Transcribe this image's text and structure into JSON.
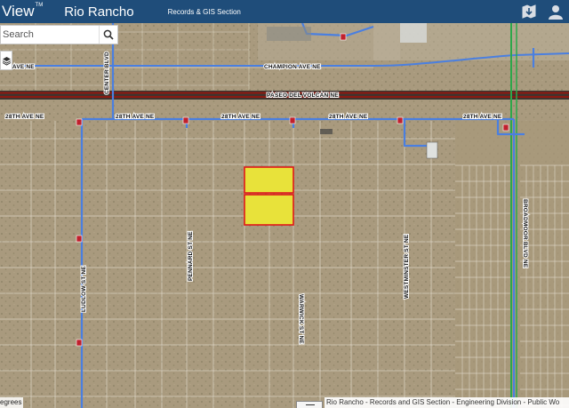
{
  "header": {
    "brand": "View",
    "brand_sup": "TM",
    "title": "Rio Rancho",
    "subtitle": "Records & GIS Section",
    "icons": [
      "map-export-icon",
      "user-icon"
    ]
  },
  "search": {
    "placeholder": "Search"
  },
  "map": {
    "roads": {
      "champion": "CHAMPION AVE NE",
      "champion_left": "ON AVE NE",
      "paseo": "PASEO DEL VOLCAN NE",
      "ave28": "28TH AVE NE",
      "center": "CENTER BLVD",
      "ludlow": "LUDLOW ST NE",
      "pennard": "PENNARD ST NE",
      "warwick": "WARWICK ST NE",
      "westminster": "WESTMINSTER ST NE",
      "broadmoor": "BROADMOOR BLVD NE"
    },
    "colors": {
      "terrain": "#a99a7e",
      "parcel_line": "#e6e0d2",
      "water_line": "#4a7fe0",
      "highway": "#8a1a12",
      "parcel_highlight_fill": "#e8e23a",
      "parcel_highlight_stroke": "#e01818",
      "green_line": "#2ca84a",
      "hydrant": "#c0202c"
    }
  },
  "footer": {
    "scale_label": "egrees",
    "attribution": "Rio Rancho - Records and GIS Section - Engineering Division - Public Wo"
  }
}
